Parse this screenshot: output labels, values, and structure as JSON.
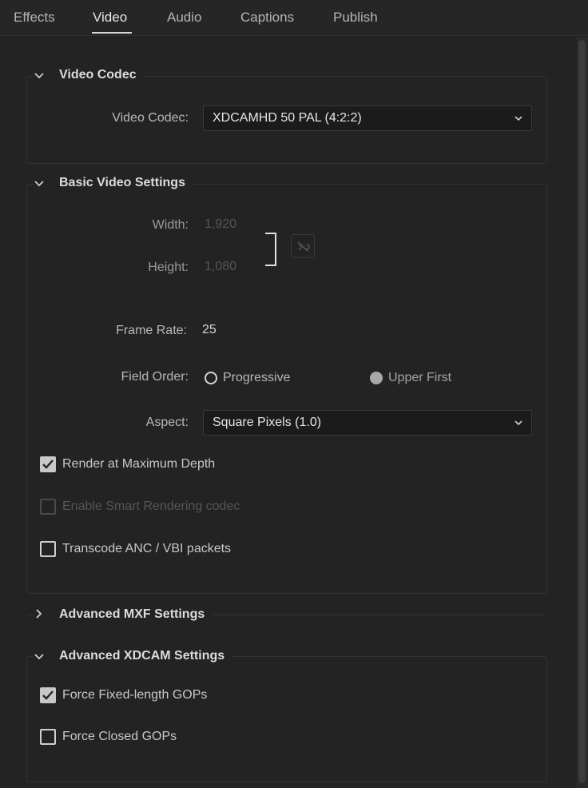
{
  "tabs": [
    {
      "label": "Effects",
      "active": false
    },
    {
      "label": "Video",
      "active": true
    },
    {
      "label": "Audio",
      "active": false
    },
    {
      "label": "Captions",
      "active": false
    },
    {
      "label": "Publish",
      "active": false
    }
  ],
  "video_codec_section": {
    "title": "Video Codec",
    "expanded": true,
    "codec_label": "Video Codec:",
    "codec_value": "XDCAMHD 50 PAL (4:2:2)"
  },
  "basic_section": {
    "title": "Basic Video Settings",
    "expanded": true,
    "width_label": "Width:",
    "width_value": "1,920",
    "height_label": "Height:",
    "height_value": "1,080",
    "frame_rate_label": "Frame Rate:",
    "frame_rate_value": "25",
    "field_order_label": "Field Order:",
    "field_order_options": [
      {
        "label": "Progressive",
        "selected": false
      },
      {
        "label": "Upper First",
        "selected": true
      }
    ],
    "aspect_label": "Aspect:",
    "aspect_value": "Square Pixels (1.0)",
    "render_max_depth": {
      "label": "Render at Maximum Depth",
      "checked": true
    },
    "smart_rendering": {
      "label": "Enable Smart Rendering codec",
      "checked": false,
      "disabled": true
    },
    "transcode_anc": {
      "label": "Transcode ANC / VBI packets",
      "checked": false
    }
  },
  "advanced_mxf_section": {
    "title": "Advanced MXF Settings",
    "expanded": false
  },
  "advanced_xdcam_section": {
    "title": "Advanced XDCAM Settings",
    "expanded": true,
    "fixed_length_gops": {
      "label": "Force Fixed-length GOPs",
      "checked": true
    },
    "closed_gops": {
      "label": "Force Closed GOPs",
      "checked": false
    }
  },
  "icons": {
    "expanded_chevron": "chevron-down-icon",
    "collapsed_chevron": "chevron-right-icon",
    "dropdown": "chevron-down-icon",
    "link": "unlink-icon"
  },
  "colors": {
    "background": "#232323",
    "text": "#c8c8c8",
    "accent_underline": "#d8d8d8"
  }
}
